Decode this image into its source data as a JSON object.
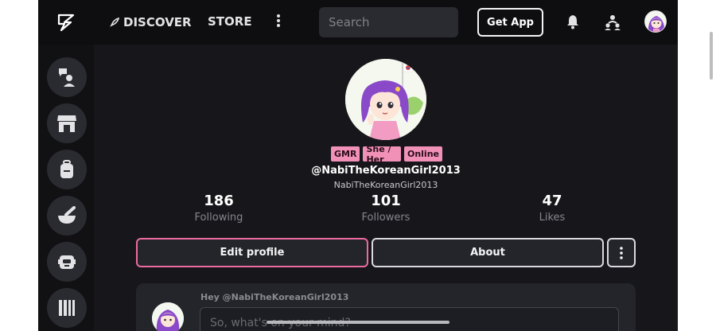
{
  "topbar": {
    "discover_label": "DISCOVER",
    "store_label": "STORE",
    "search_placeholder": "Search",
    "get_app_label": "Get App"
  },
  "sidebar": {
    "items": [
      {
        "icon": "chat-person-icon"
      },
      {
        "icon": "storefront-icon"
      },
      {
        "icon": "backpack-icon"
      },
      {
        "icon": "mortar-pestle-icon"
      },
      {
        "icon": "robot-icon"
      },
      {
        "icon": "library-icon"
      }
    ]
  },
  "profile": {
    "badges": [
      "GMR",
      "She / Her",
      "Online"
    ],
    "handle": "@NabiTheKoreanGirl2013",
    "display_name": "NabiTheKoreanGirl2013",
    "stats": [
      {
        "value": "186",
        "label": "Following"
      },
      {
        "value": "101",
        "label": "Followers"
      },
      {
        "value": "47",
        "label": "Likes"
      }
    ],
    "edit_label": "Edit profile",
    "about_label": "About"
  },
  "composer": {
    "greeting": "Hey @NabiTheKoreanGirl2013",
    "placeholder": "So, what's on your mind?"
  },
  "colors": {
    "accent_pink": "#ec6ba0",
    "badge_pink": "#f291b8",
    "background": "#17171b"
  }
}
